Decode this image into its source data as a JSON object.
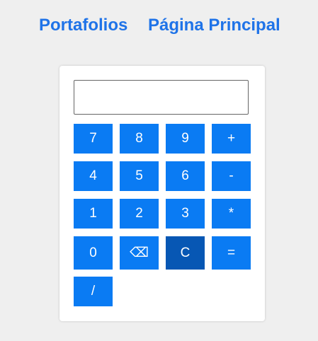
{
  "nav": {
    "portafolios": "Portafolios",
    "principal": "Página Principal"
  },
  "calculator": {
    "display_value": "",
    "keys": {
      "seven": "7",
      "eight": "8",
      "nine": "9",
      "plus": "+",
      "four": "4",
      "five": "5",
      "six": "6",
      "minus": "-",
      "one": "1",
      "two": "2",
      "three": "3",
      "multiply": "*",
      "zero": "0",
      "backspace": "⌫",
      "clear": "C",
      "equals": "=",
      "divide": "/"
    }
  },
  "colors": {
    "link": "#1f73e8",
    "key": "#0a7bf3",
    "key_clear": "#0757b4",
    "background": "#efefef"
  }
}
